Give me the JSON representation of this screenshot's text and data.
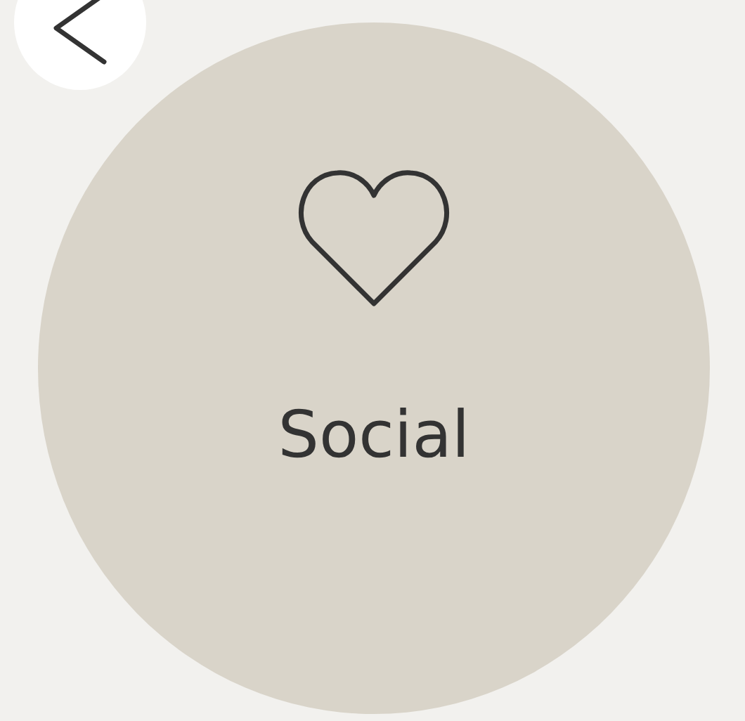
{
  "category": {
    "title": "Social"
  }
}
